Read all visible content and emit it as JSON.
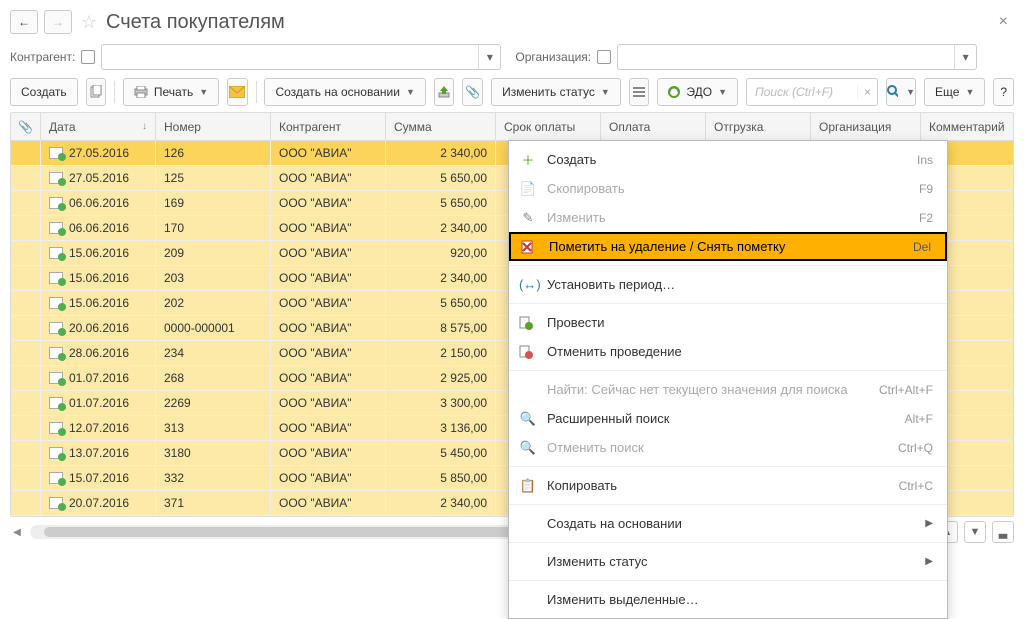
{
  "header": {
    "title": "Счета покупателям"
  },
  "filters": {
    "kontragent_label": "Контрагент:",
    "org_label": "Организация:"
  },
  "toolbar": {
    "create": "Создать",
    "print": "Печать",
    "create_basis": "Создать на основании",
    "change_status": "Изменить статус",
    "edo": "ЭДО",
    "search_placeholder": "Поиск (Ctrl+F)",
    "more": "Еще"
  },
  "columns": {
    "date": "Дата",
    "number": "Номер",
    "kontragent": "Контрагент",
    "sum": "Сумма",
    "pay_term": "Срок оплаты",
    "payment": "Оплата",
    "shipment": "Отгрузка",
    "org": "Организация",
    "comment": "Комментарий"
  },
  "rows": [
    {
      "date": "27.05.2016",
      "num": "126",
      "k": "ООО \"АВИА\"",
      "sum": "2 340,00"
    },
    {
      "date": "27.05.2016",
      "num": "125",
      "k": "ООО \"АВИА\"",
      "sum": "5 650,00"
    },
    {
      "date": "06.06.2016",
      "num": "169",
      "k": "ООО \"АВИА\"",
      "sum": "5 650,00"
    },
    {
      "date": "06.06.2016",
      "num": "170",
      "k": "ООО \"АВИА\"",
      "sum": "2 340,00"
    },
    {
      "date": "15.06.2016",
      "num": "209",
      "k": "ООО \"АВИА\"",
      "sum": "920,00"
    },
    {
      "date": "15.06.2016",
      "num": "203",
      "k": "ООО \"АВИА\"",
      "sum": "2 340,00"
    },
    {
      "date": "15.06.2016",
      "num": "202",
      "k": "ООО \"АВИА\"",
      "sum": "5 650,00"
    },
    {
      "date": "20.06.2016",
      "num": "0000-000001",
      "k": "ООО \"АВИА\"",
      "sum": "8 575,00"
    },
    {
      "date": "28.06.2016",
      "num": "234",
      "k": "ООО \"АВИА\"",
      "sum": "2 150,00"
    },
    {
      "date": "01.07.2016",
      "num": "268",
      "k": "ООО \"АВИА\"",
      "sum": "2 925,00"
    },
    {
      "date": "01.07.2016",
      "num": "2269",
      "k": "ООО \"АВИА\"",
      "sum": "3 300,00"
    },
    {
      "date": "12.07.2016",
      "num": "313",
      "k": "ООО \"АВИА\"",
      "sum": "3 136,00"
    },
    {
      "date": "13.07.2016",
      "num": "3180",
      "k": "ООО \"АВИА\"",
      "sum": "5 450,00"
    },
    {
      "date": "15.07.2016",
      "num": "332",
      "k": "ООО \"АВИА\"",
      "sum": "5 850,00"
    },
    {
      "date": "20.07.2016",
      "num": "371",
      "k": "ООО \"АВИА\"",
      "sum": "2 340,00"
    }
  ],
  "menu": {
    "create": {
      "label": "Создать",
      "hot": "Ins"
    },
    "copy": {
      "label": "Скопировать",
      "hot": "F9"
    },
    "edit": {
      "label": "Изменить",
      "hot": "F2"
    },
    "mark_delete": {
      "label": "Пометить на удаление / Снять пометку",
      "hot": "Del"
    },
    "set_period": {
      "label": "Установить период…",
      "hot": ""
    },
    "post": {
      "label": "Провести",
      "hot": ""
    },
    "unpost": {
      "label": "Отменить проведение",
      "hot": ""
    },
    "find": {
      "label": "Найти: Сейчас нет текущего значения для поиска",
      "hot": "Ctrl+Alt+F"
    },
    "adv_find": {
      "label": "Расширенный поиск",
      "hot": "Alt+F"
    },
    "cancel_find": {
      "label": "Отменить поиск",
      "hot": "Ctrl+Q"
    },
    "copy2": {
      "label": "Копировать",
      "hot": "Ctrl+C"
    },
    "create_basis": {
      "label": "Создать на основании",
      "hot": ""
    },
    "change_status": {
      "label": "Изменить статус",
      "hot": ""
    },
    "change_sel": {
      "label": "Изменить выделенные…",
      "hot": ""
    }
  }
}
